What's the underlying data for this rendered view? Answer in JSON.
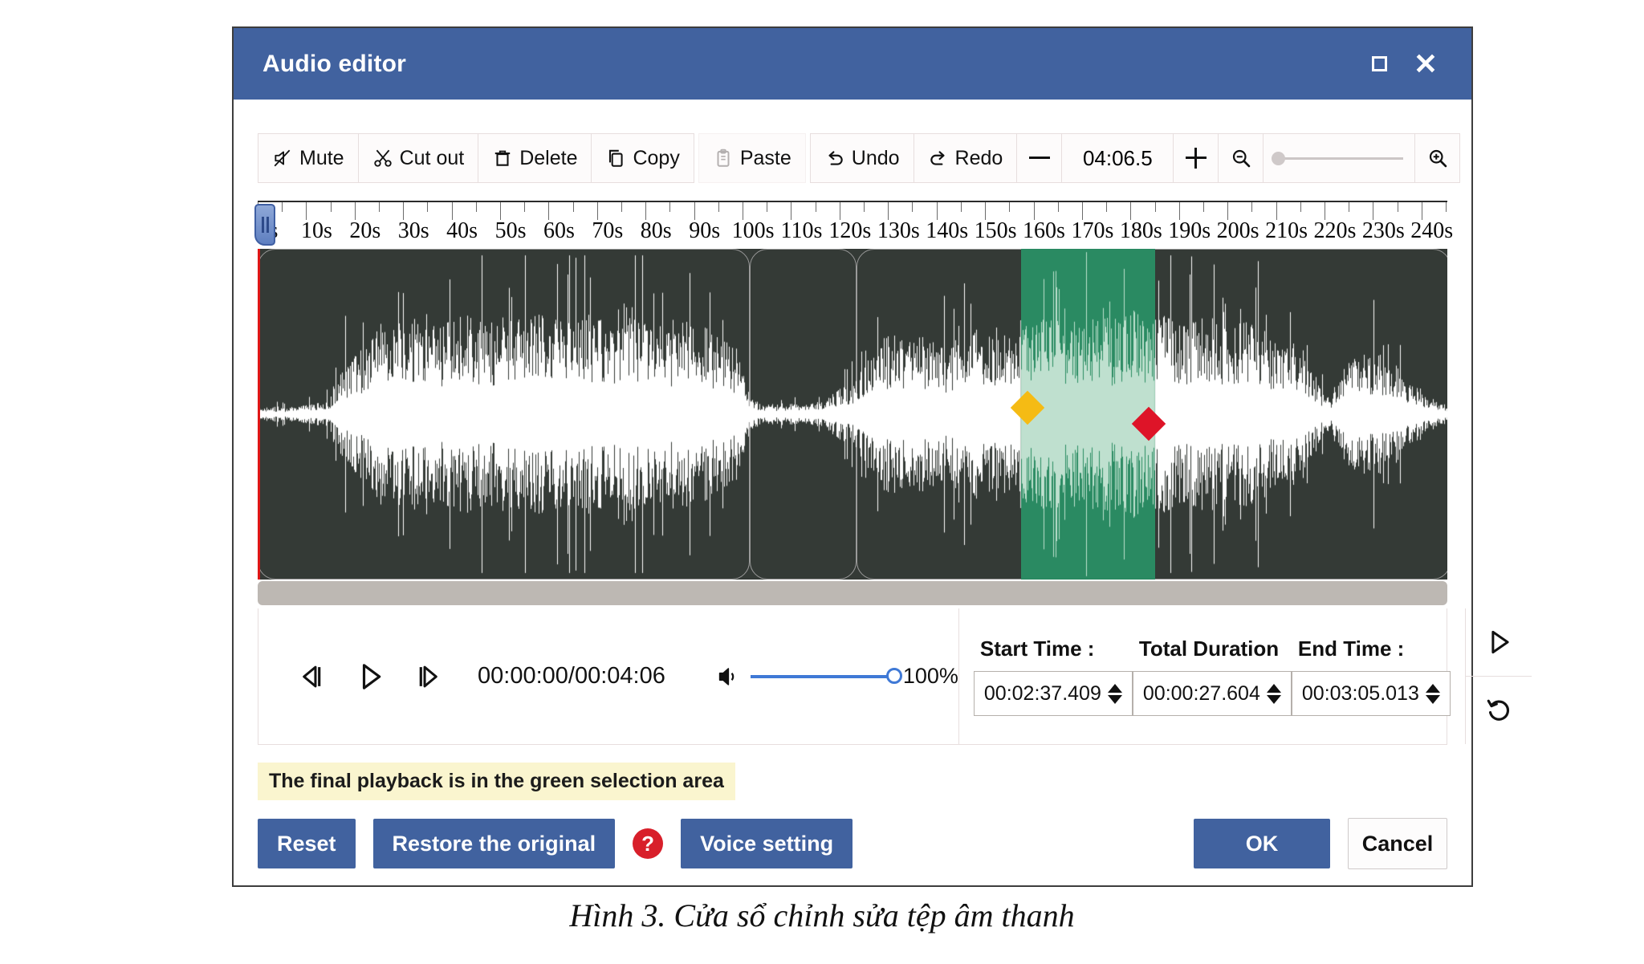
{
  "window": {
    "title": "Audio editor",
    "maximize_icon": "maximize-icon",
    "close_icon": "close-icon"
  },
  "toolbar": {
    "buttons": [
      {
        "label": "Mute",
        "icon": "mute-icon"
      },
      {
        "label": "Cut out",
        "icon": "scissors-icon"
      },
      {
        "label": "Delete",
        "icon": "trash-icon"
      },
      {
        "label": "Copy",
        "icon": "copy-icon"
      },
      {
        "label": "Paste",
        "icon": "clipboard-icon"
      },
      {
        "label": "Undo",
        "icon": "undo-arrow-icon"
      },
      {
        "label": "Redo",
        "icon": "redo-arrow-icon"
      }
    ],
    "duration_value": "04:06.5",
    "decrease_icon": "minus-icon",
    "increase_icon": "plus-icon",
    "zoom_out_icon": "zoom-out-icon",
    "zoom_in_icon": "zoom-in-icon",
    "zoom_slider_value": 0
  },
  "ruler": {
    "unit_suffix": "s",
    "labels": [
      "0s",
      "10s",
      "20s",
      "30s",
      "40s",
      "50s",
      "60s",
      "70s",
      "80s",
      "90s",
      "100s",
      "110s",
      "120s",
      "130s",
      "140s",
      "150s",
      "160s",
      "170s",
      "180s",
      "190s",
      "200s",
      "210s",
      "220s",
      "230s",
      "240s"
    ],
    "max_seconds": 246,
    "playhead_seconds": 0
  },
  "waveform": {
    "background_color": "#343a36",
    "wave_color": "#ffffff",
    "selection_color": "#2a8a62",
    "selection_wave_color": "#bfe0cf",
    "playhead_color": "#e01616",
    "selection_start_seconds": 157.4,
    "selection_end_seconds": 185.0,
    "start_marker_icon": "start-marker-diamond-icon",
    "end_marker_icon": "end-marker-diamond-icon",
    "clip_boundaries_seconds": [
      0,
      101.5,
      123.5,
      246
    ]
  },
  "transport": {
    "prev_frame_icon": "step-back-icon",
    "play_icon": "play-icon",
    "next_frame_icon": "step-forward-icon",
    "time_readout": "00:00:00/00:04:06",
    "volume_icon": "speaker-icon",
    "volume_percent": "100%",
    "volume_value": 100
  },
  "time_fields": [
    {
      "label": "Start Time :",
      "value": "00:02:37.409",
      "name": "start-time"
    },
    {
      "label": "Total Duration",
      "value": "00:00:27.604",
      "name": "total-duration"
    },
    {
      "label": "End Time :",
      "value": "00:03:05.013",
      "name": "end-time"
    }
  ],
  "side_actions": {
    "preview_play_icon": "play-outline-icon",
    "reset_loop_icon": "reset-loop-icon"
  },
  "hint": {
    "text": "The final playback is in the green selection area",
    "background_color": "#faf5cf"
  },
  "footer": {
    "reset_label": "Reset",
    "restore_label": "Restore the original",
    "help_icon": "help-question-icon",
    "help_glyph": "?",
    "voice_setting_label": "Voice setting",
    "ok_label": "OK",
    "cancel_label": "Cancel",
    "primary_color": "#41629f"
  },
  "caption": {
    "text": "Hình 3. Cửa sổ chỉnh sửa tệp âm thanh"
  }
}
